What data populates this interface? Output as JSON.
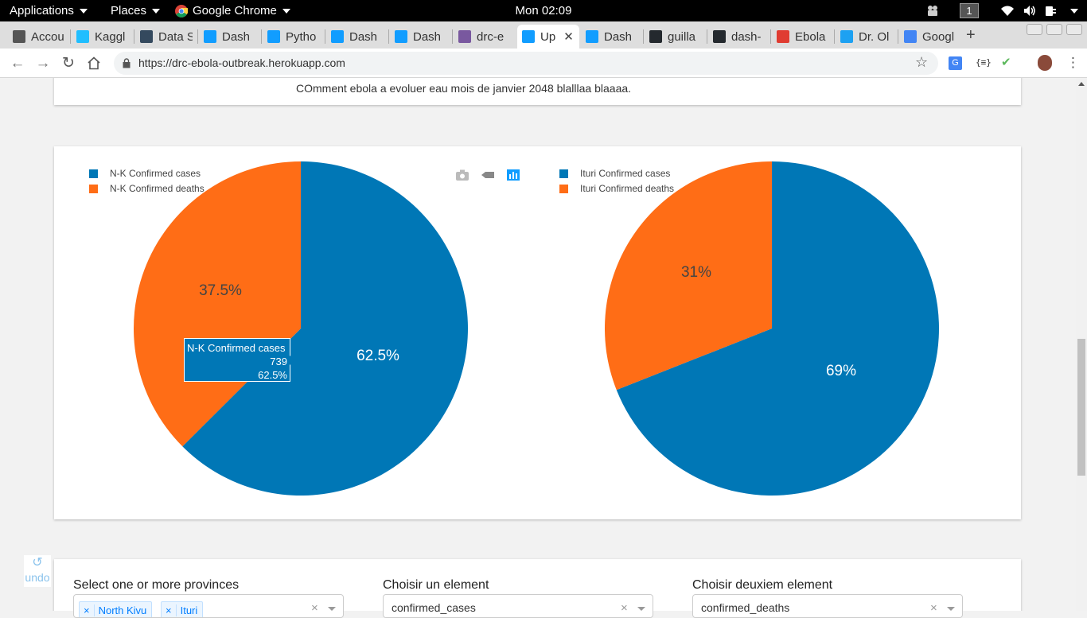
{
  "topbar": {
    "applications": "Applications",
    "places": "Places",
    "browser": "Google Chrome",
    "clock": "Mon 02:09",
    "workspace": "1"
  },
  "tabs": [
    {
      "label": "Accou",
      "color": "#555555"
    },
    {
      "label": "Kaggl",
      "color": "#20beff"
    },
    {
      "label": "Data S",
      "color": "#34495e"
    },
    {
      "label": "Dash",
      "color": "#119dff"
    },
    {
      "label": "Pytho",
      "color": "#119dff"
    },
    {
      "label": "Dash",
      "color": "#119dff"
    },
    {
      "label": "Dash",
      "color": "#119dff"
    },
    {
      "label": "drc-e",
      "color": "#79589f"
    },
    {
      "label": "Up",
      "color": "#119dff",
      "active": true
    },
    {
      "label": "Dash",
      "color": "#119dff"
    },
    {
      "label": "guilla",
      "color": "#24292e"
    },
    {
      "label": "dash-",
      "color": "#24292e"
    },
    {
      "label": "Ebola",
      "color": "#e03c31"
    },
    {
      "label": "Dr. Ol",
      "color": "#1da1f2"
    },
    {
      "label": "Googl",
      "color": "#4285f4"
    }
  ],
  "toolbar": {
    "url": "https://drc-ebola-outbreak.herokuapp.com"
  },
  "comment": "COmment ebola a evoluer eau mois de janvier 2048 blalllaa blaaaa.",
  "colors": {
    "cases": "#0077b6",
    "deaths": "#ff6d16"
  },
  "chart_data": [
    {
      "type": "pie",
      "labels": [
        "N-K Confirmed cases",
        "N-K Confirmed deaths"
      ],
      "values": [
        739,
        443
      ],
      "percent_labels": [
        "62.5%",
        "37.5%"
      ],
      "colors": [
        "#0077b6",
        "#ff6d16"
      ],
      "legend": "top-left"
    },
    {
      "type": "pie",
      "labels": [
        "Ituri Confirmed cases",
        "Ituri Confirmed deaths"
      ],
      "values": [
        69,
        31
      ],
      "percent_labels": [
        "69%",
        "31%"
      ],
      "colors": [
        "#0077b6",
        "#ff6d16"
      ],
      "legend": "top-left"
    }
  ],
  "tooltip": {
    "title": "N-K Confirmed cases",
    "value": "739",
    "percent": "62.5%"
  },
  "undo": "undo",
  "controls": {
    "provinces_label": "Select one or more provinces",
    "provinces_selected": [
      "North Kivu",
      "Ituri"
    ],
    "element1_label": "Choisir un element",
    "element1_value": "confirmed_cases",
    "element2_label": "Choisir deuxiem element",
    "element2_value": "confirmed_deaths"
  }
}
